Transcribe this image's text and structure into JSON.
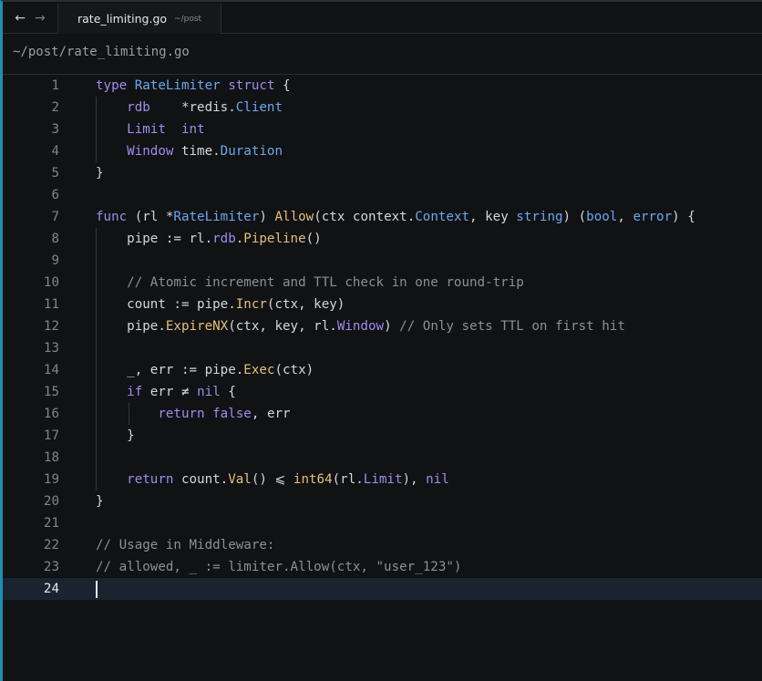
{
  "tabbar": {
    "back_icon": "←",
    "forward_icon": "→",
    "tab_title": "rate_limiting.go",
    "tab_path": "~/post"
  },
  "breadcrumb": "~/post/rate_limiting.go",
  "editor": {
    "current_line": 24,
    "lines": [
      {
        "n": "1",
        "html": "<span class=\"k\">type</span> <span class=\"y\">RateLimiter</span> <span class=\"k\">struct</span> {"
      },
      {
        "n": "2",
        "html": "    <span class=\"k\">rdb</span>    *redis.<span class=\"y\">Client</span>"
      },
      {
        "n": "3",
        "html": "    <span class=\"k\">Limit</span>  <span class=\"t\">int</span>"
      },
      {
        "n": "4",
        "html": "    <span class=\"k\">Window</span> time.<span class=\"y\">Duration</span>"
      },
      {
        "n": "5",
        "html": "}"
      },
      {
        "n": "6",
        "html": ""
      },
      {
        "n": "7",
        "html": "<span class=\"k\">func</span> (rl *<span class=\"y\">RateLimiter</span>) <span class=\"f\">Allow</span>(ctx context.<span class=\"y\">Context</span>, key <span class=\"y\">string</span>) (<span class=\"y\">bool</span>, <span class=\"y\">error</span>) {"
      },
      {
        "n": "8",
        "html": "    pipe := rl.<span class=\"k\">rdb</span>.<span class=\"f\">Pipeline</span>()"
      },
      {
        "n": "9",
        "html": ""
      },
      {
        "n": "10",
        "html": "    <span class=\"c\">// Atomic increment and TTL check in one round-trip</span>"
      },
      {
        "n": "11",
        "html": "    count := pipe.<span class=\"f\">Incr</span>(ctx, key)"
      },
      {
        "n": "12",
        "html": "    pipe.<span class=\"f\">ExpireNX</span>(ctx, key, rl.<span class=\"k\">Window</span>) <span class=\"c\">// Only sets TTL on first hit</span>"
      },
      {
        "n": "13",
        "html": ""
      },
      {
        "n": "14",
        "html": "    _, err := pipe.<span class=\"f\">Exec</span>(ctx)"
      },
      {
        "n": "15",
        "html": "    <span class=\"k\">if</span> err ≠ <span class=\"k\">nil</span> {"
      },
      {
        "n": "16",
        "html": "        <span class=\"k\">return</span> <span class=\"k\">false</span>, err"
      },
      {
        "n": "17",
        "html": "    }"
      },
      {
        "n": "18",
        "html": ""
      },
      {
        "n": "19",
        "html": "    <span class=\"k\">return</span> count.<span class=\"f\">Val</span>() ⩽ <span class=\"f\">int64</span>(rl.<span class=\"k\">Limit</span>), <span class=\"k\">nil</span>"
      },
      {
        "n": "20",
        "html": "}"
      },
      {
        "n": "21",
        "html": ""
      },
      {
        "n": "22",
        "html": "<span class=\"c\">// Usage in Middleware:</span>"
      },
      {
        "n": "23",
        "html": "<span class=\"c\">// allowed, _ := limiter.Allow(ctx, \"user_123\")</span>"
      },
      {
        "n": "24",
        "html": ""
      }
    ]
  }
}
